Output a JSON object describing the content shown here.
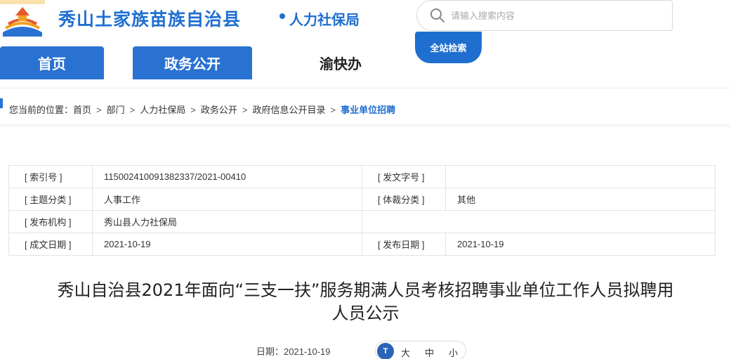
{
  "header": {
    "site_title": "秀山土家族苗族自治县",
    "dept_title": "人力社保局",
    "colors": {
      "primary": "#1f6fd1",
      "nav_active": "#2a72d2"
    }
  },
  "search": {
    "placeholder": "请输入搜索内容",
    "button_label": "全站检索",
    "icon": "search-icon"
  },
  "nav": {
    "tabs": [
      {
        "label": "首页",
        "active": true
      },
      {
        "label": "政务公开",
        "active": true
      },
      {
        "label": "渝快办",
        "active": false
      }
    ]
  },
  "breadcrumb": {
    "prefix": "您当前的位置：",
    "items": [
      "首页",
      "部门",
      "人力社保局",
      "政务公开",
      "政府信息公开目录"
    ],
    "current": "事业单位招聘",
    "separator": ">"
  },
  "info_table": {
    "rows": [
      {
        "k1": "[ 索引号 ]",
        "v1": "11500241009138233​7/2021-00410",
        "k2": "[ 发文字号 ]",
        "v2": ""
      },
      {
        "k1": "[ 主题分类 ]",
        "v1": "人事工作",
        "k2": "[ 体裁分类 ]",
        "v2": "其他"
      },
      {
        "k1": "[ 发布机构 ]",
        "v1": "秀山县人力社保局",
        "k2": "",
        "v2": ""
      },
      {
        "k1": "[ 成文日期 ]",
        "v1": "2021-10-19",
        "k2": "[ 发布日期 ]",
        "v2": "2021-10-19"
      }
    ]
  },
  "article": {
    "title_line1": "秀山自治县2021年面向“三支一扶”服务期满人员考核招聘事业单位工作人员拟聘用",
    "title_line2": "人员公示",
    "date_label": "日期：2021-10-19",
    "font_sizes": [
      "大",
      "中",
      "小"
    ],
    "font_icon_text": "T"
  }
}
